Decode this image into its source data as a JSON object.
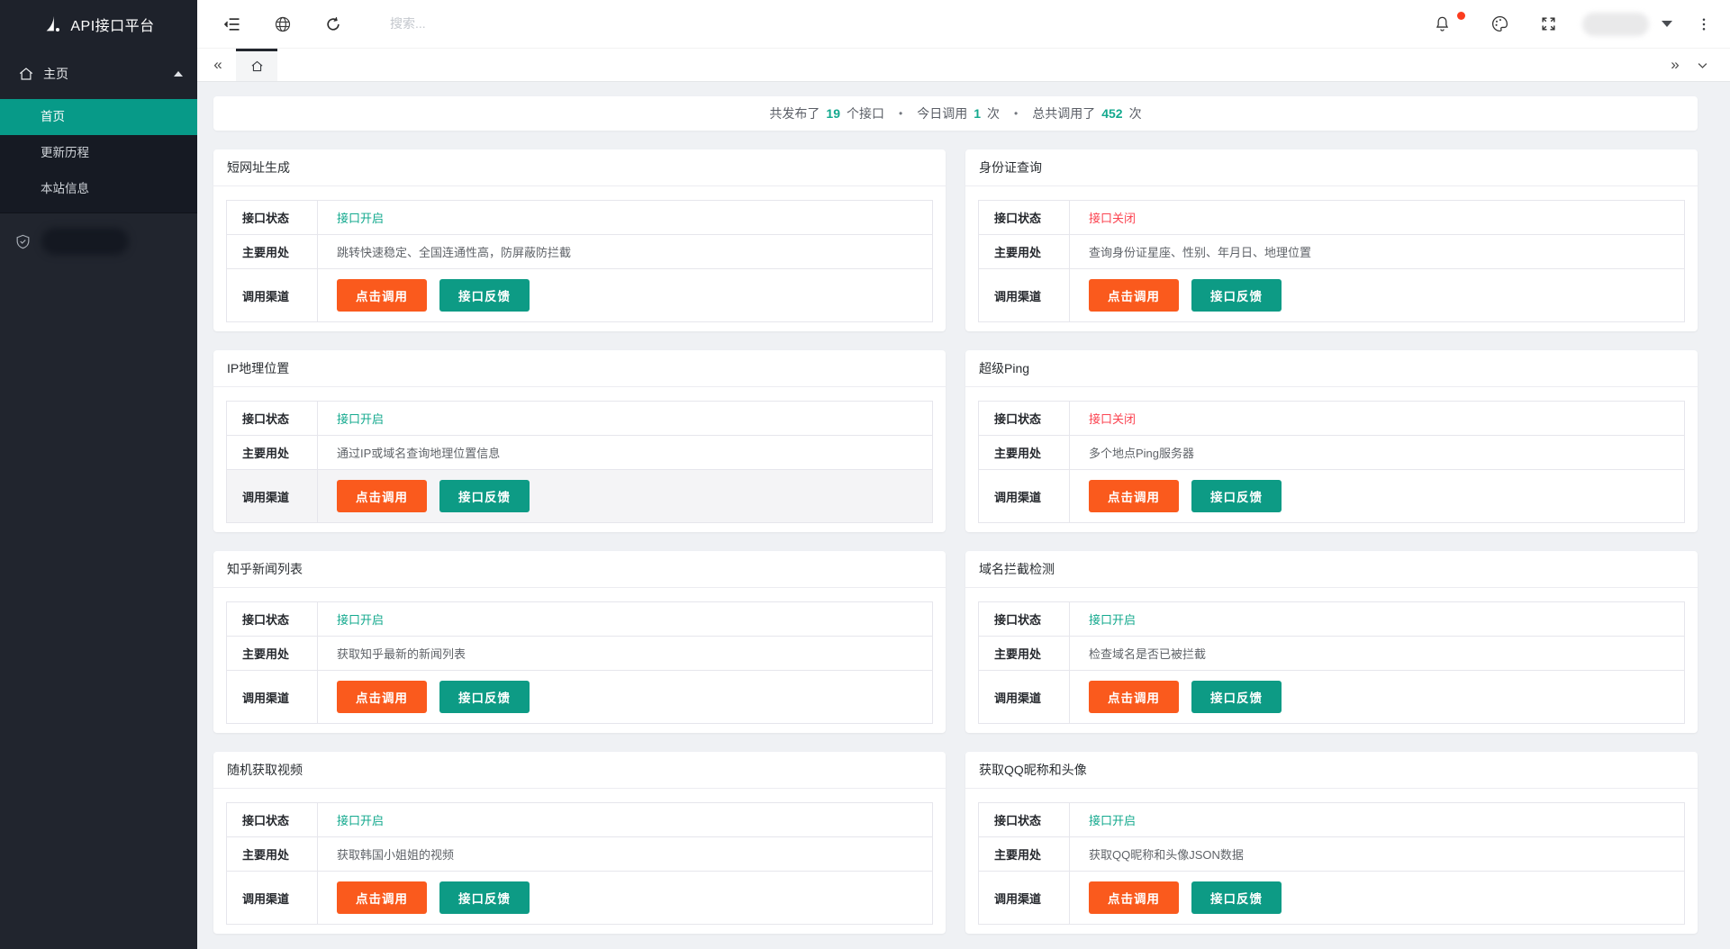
{
  "sidebar": {
    "logo_text": "API接口平台",
    "menu_home": {
      "label": "主页",
      "expanded": true
    },
    "submenu": [
      {
        "label": "首页",
        "active": true
      },
      {
        "label": "更新历程",
        "active": false
      },
      {
        "label": "本站信息",
        "active": false
      }
    ]
  },
  "header": {
    "search_placeholder": "搜索...",
    "icons": [
      "menu-fold-icon",
      "globe-icon",
      "refresh-icon",
      "bell-icon",
      "palette-icon",
      "fullscreen-icon",
      "caret-down-icon",
      "kebab-icon"
    ],
    "bell_has_red_dot": true
  },
  "tabbar": {
    "left_chevron": "«",
    "right_chevron": "»",
    "active_tab": "home"
  },
  "stats": {
    "part1": "共发布了",
    "published_count": "19",
    "part2": "个接口",
    "bullet": "•",
    "part3": "今日调用",
    "today_count": "1",
    "part4": "次",
    "part5": "总共调用了",
    "total_count": "452",
    "part6": "次"
  },
  "table_labels": {
    "status": "接口状态",
    "usage": "主要用处",
    "channel": "调用渠道"
  },
  "status_text": {
    "open": "接口开启",
    "closed": "接口关闭"
  },
  "buttons": {
    "call": "点击调用",
    "feedback": "接口反馈"
  },
  "cards": [
    {
      "title": "短网址生成",
      "status": "open",
      "usage": "跳转快速稳定、全国连通性高，防屏蔽防拦截",
      "hover_row": false
    },
    {
      "title": "身份证查询",
      "status": "closed",
      "usage": "查询身份证星座、性别、年月日、地理位置",
      "hover_row": false
    },
    {
      "title": "IP地理位置",
      "status": "open",
      "usage": "通过IP或域名查询地理位置信息",
      "hover_row": true
    },
    {
      "title": "超级Ping",
      "status": "closed",
      "usage": "多个地点Ping服务器",
      "hover_row": false
    },
    {
      "title": "知乎新闻列表",
      "status": "open",
      "usage": "获取知乎最新的新闻列表",
      "hover_row": false
    },
    {
      "title": "域名拦截检测",
      "status": "open",
      "usage": "检查域名是否已被拦截",
      "hover_row": false
    },
    {
      "title": "随机获取视频",
      "status": "open",
      "usage": "获取韩国小姐姐的视频",
      "hover_row": false
    },
    {
      "title": "获取QQ昵称和头像",
      "status": "open",
      "usage": "获取QQ昵称和头像JSON数据",
      "hover_row": false
    }
  ],
  "colors": {
    "accent_teal": "#13a98e",
    "button_teal": "#0d9b85",
    "button_orange": "#fa5a1d",
    "status_red": "#fb4350",
    "sidebar_active": "#079a88",
    "sidebar_bg": "#1e222b",
    "content_bg": "#eff1f4",
    "notification_dot": "#fb3c1e"
  }
}
